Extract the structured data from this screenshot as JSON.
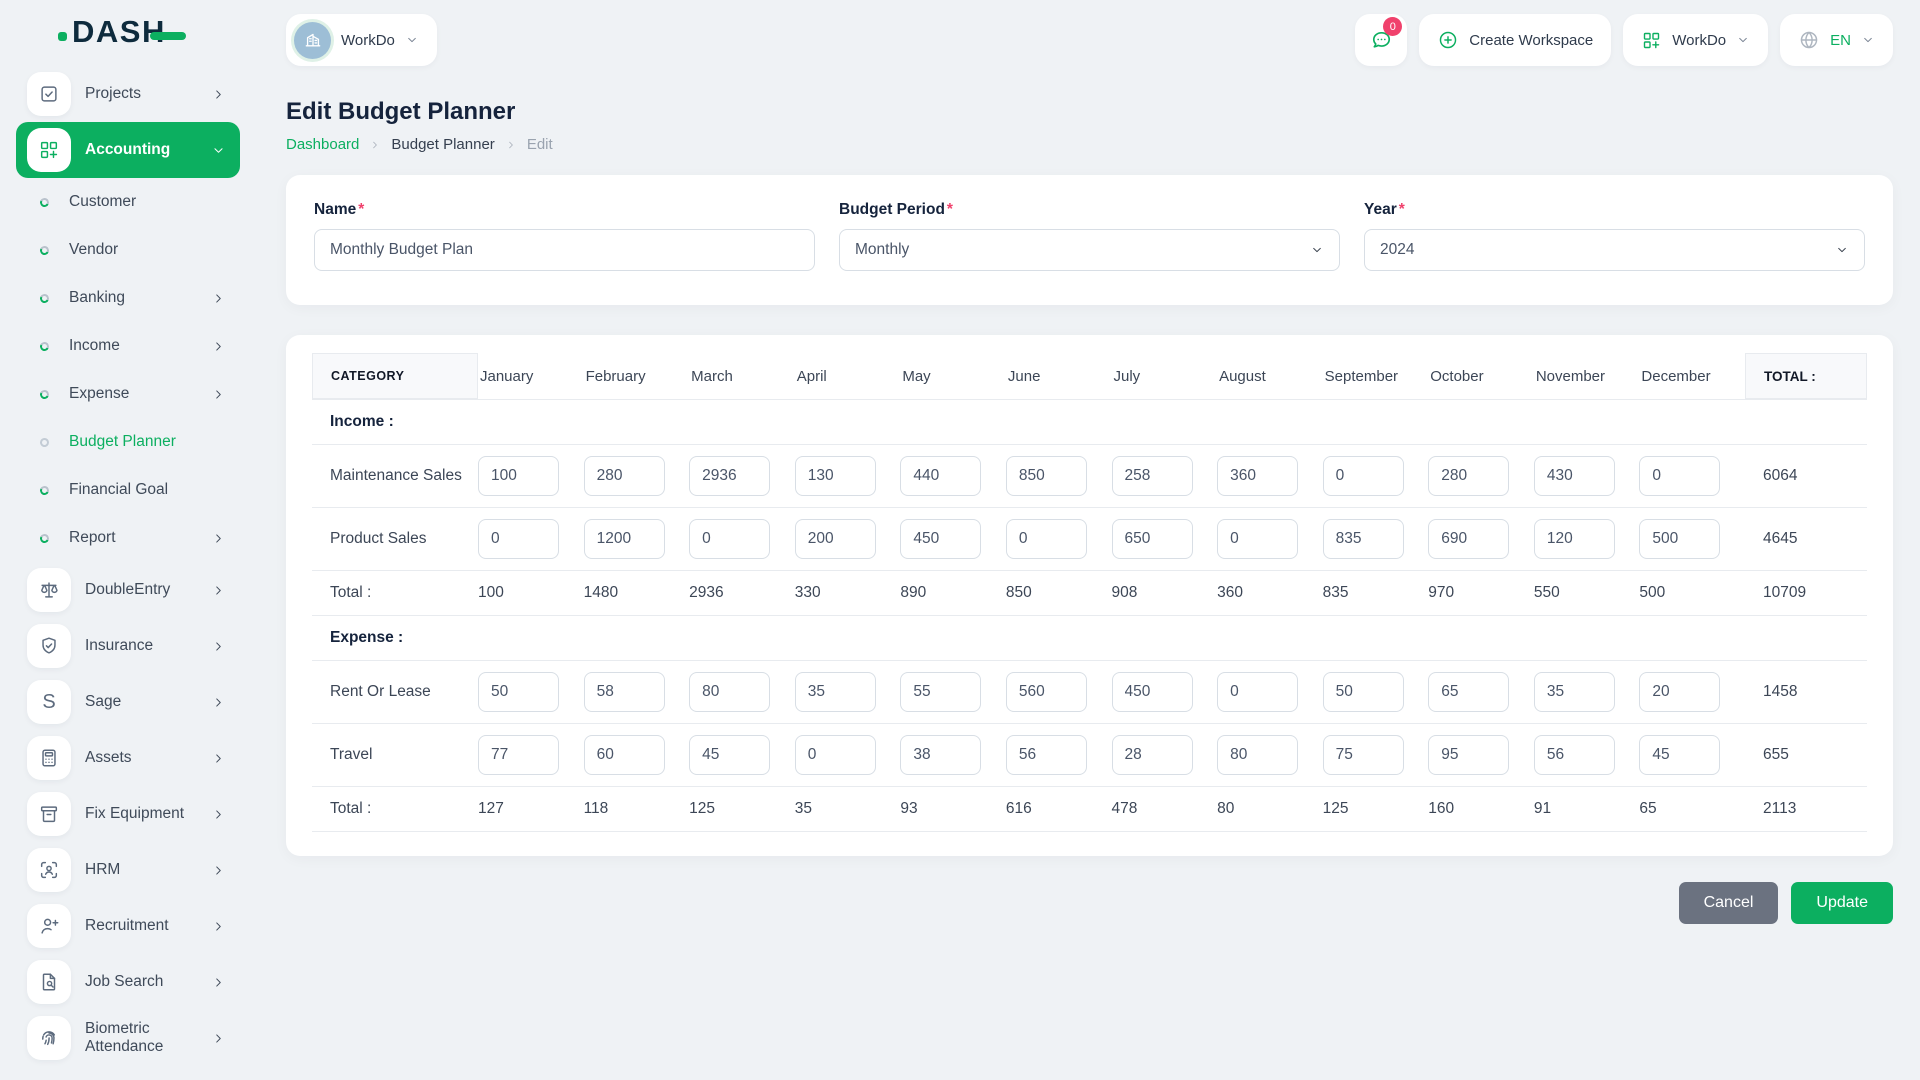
{
  "brand": {
    "name": "DASH"
  },
  "topbar": {
    "workspace": {
      "name": "WorkDo",
      "icon": "building"
    },
    "messages": {
      "icon": "chat",
      "badge": "0"
    },
    "create_workspace": {
      "label": "Create Workspace",
      "icon": "plus-circle"
    },
    "workspace_menu": {
      "label": "WorkDo",
      "icon": "grid-plus"
    },
    "language": {
      "label": "EN",
      "icon": "globe"
    }
  },
  "sidebar": {
    "items": [
      {
        "label": "Projects",
        "type": "box",
        "icon": "tasks",
        "chevron": "right"
      },
      {
        "label": "Accounting",
        "type": "box",
        "icon": "grid-plus",
        "chevron": "down",
        "active": true
      },
      {
        "label": "Customer",
        "type": "sub"
      },
      {
        "label": "Vendor",
        "type": "sub"
      },
      {
        "label": "Banking",
        "type": "sub",
        "chevron": "right"
      },
      {
        "label": "Income",
        "type": "sub",
        "chevron": "right"
      },
      {
        "label": "Expense",
        "type": "sub",
        "chevron": "right"
      },
      {
        "label": "Budget Planner",
        "type": "sub",
        "active": true
      },
      {
        "label": "Financial Goal",
        "type": "sub"
      },
      {
        "label": "Report",
        "type": "sub",
        "chevron": "right"
      },
      {
        "label": "DoubleEntry",
        "type": "box",
        "icon": "scales",
        "chevron": "right"
      },
      {
        "label": "Insurance",
        "type": "box",
        "icon": "shield-check",
        "chevron": "right"
      },
      {
        "label": "Sage",
        "type": "box",
        "icon": "letter-s",
        "chevron": "right"
      },
      {
        "label": "Assets",
        "type": "box",
        "icon": "calculator",
        "chevron": "right"
      },
      {
        "label": "Fix Equipment",
        "type": "box",
        "icon": "archive-box",
        "chevron": "right"
      },
      {
        "label": "HRM",
        "type": "box",
        "icon": "user-focus",
        "chevron": "right"
      },
      {
        "label": "Recruitment",
        "type": "box",
        "icon": "user-plus",
        "chevron": "right"
      },
      {
        "label": "Job Search",
        "type": "box",
        "icon": "document-search",
        "chevron": "right"
      },
      {
        "label": "Biometric Attendance",
        "type": "box",
        "icon": "fingerprint",
        "chevron": "right"
      }
    ]
  },
  "page": {
    "title": "Edit Budget Planner",
    "breadcrumb": [
      "Dashboard",
      "Budget Planner",
      "Edit"
    ]
  },
  "form": {
    "required_mark": "*",
    "fields": {
      "name": {
        "label": "Name",
        "value": "Monthly Budget Plan"
      },
      "period": {
        "label": "Budget Period",
        "value": "Monthly"
      },
      "year": {
        "label": "Year",
        "value": "2024"
      }
    }
  },
  "budget_table": {
    "category_header": "CATEGORY",
    "total_header": "TOTAL :",
    "months": [
      "January",
      "February",
      "March",
      "April",
      "May",
      "June",
      "July",
      "August",
      "September",
      "October",
      "November",
      "December"
    ],
    "sections": [
      {
        "label": "Income :",
        "rows": [
          {
            "name": "Maintenance Sales",
            "values": [
              100,
              280,
              2936,
              130,
              440,
              850,
              258,
              360,
              0,
              280,
              430,
              0
            ],
            "total": 6064
          },
          {
            "name": "Product Sales",
            "values": [
              0,
              1200,
              0,
              200,
              450,
              0,
              650,
              0,
              835,
              690,
              120,
              500
            ],
            "total": 4645
          }
        ],
        "total_row": {
          "label": "Total :",
          "values": [
            100,
            1480,
            2936,
            330,
            890,
            850,
            908,
            360,
            835,
            970,
            550,
            500
          ],
          "total": 10709
        }
      },
      {
        "label": "Expense :",
        "rows": [
          {
            "name": "Rent Or Lease",
            "values": [
              50,
              58,
              80,
              35,
              55,
              560,
              450,
              0,
              50,
              65,
              35,
              20
            ],
            "total": 1458
          },
          {
            "name": "Travel",
            "values": [
              77,
              60,
              45,
              0,
              38,
              56,
              28,
              80,
              75,
              95,
              56,
              45
            ],
            "total": 655
          }
        ],
        "total_row": {
          "label": "Total :",
          "values": [
            127,
            118,
            125,
            35,
            93,
            616,
            478,
            80,
            125,
            160,
            91,
            65
          ],
          "total": 2113
        }
      }
    ]
  },
  "actions": {
    "cancel_label": "Cancel",
    "update_label": "Update"
  },
  "colors": {
    "primary": "#0caf60",
    "danger": "#f0416c",
    "cancel_gray": "#6b7280"
  }
}
